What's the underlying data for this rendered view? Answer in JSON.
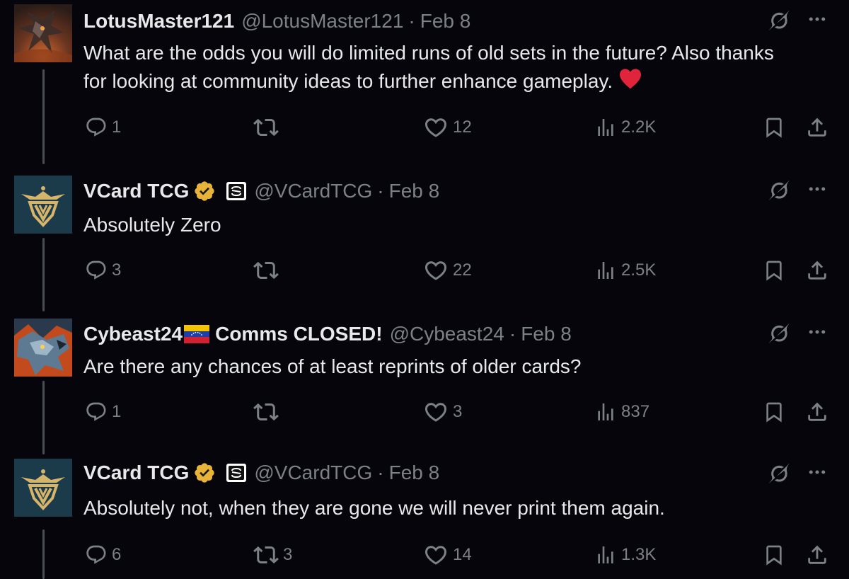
{
  "tweets": [
    {
      "name": "LotusMaster121",
      "handle": "@LotusMaster121",
      "separator": "·",
      "date": "Feb 8",
      "verified": false,
      "affiliate": false,
      "text": "What are the odds you will do limited runs of old sets in the future? Also thanks for looking at community ideas to further enhance gameplay.",
      "emoji": "red-heart",
      "replies": "1",
      "reposts": "",
      "likes": "12",
      "views": "2.2K",
      "avatar": "dragon-avatar"
    },
    {
      "name": "VCard TCG",
      "handle": "@VCardTCG",
      "separator": "·",
      "date": "Feb 8",
      "verified": true,
      "affiliate": true,
      "text": "Absolutely Zero",
      "replies": "3",
      "reposts": "",
      "likes": "22",
      "views": "2.5K",
      "avatar": "vcard-logo-avatar"
    },
    {
      "name": "Cybeast24",
      "name_suffix": "Comms CLOSED!",
      "handle": "@Cybeast24",
      "separator": "·",
      "date": "Feb 8",
      "verified": false,
      "affiliate": false,
      "flag": "venezuela-flag",
      "text": "Are there any chances of at least reprints of older cards?",
      "replies": "1",
      "reposts": "",
      "likes": "3",
      "views": "837",
      "avatar": "mech-dragon-avatar"
    },
    {
      "name": "VCard TCG",
      "handle": "@VCardTCG",
      "separator": "·",
      "date": "Feb 8",
      "verified": true,
      "affiliate": true,
      "text": "Absolutely not, when they are gone we will never print them again.",
      "replies": "6",
      "reposts": "3",
      "likes": "14",
      "views": "1.3K",
      "avatar": "vcard-logo-avatar"
    }
  ],
  "colors": {
    "background": "#06050b",
    "text": "#e7e9ea",
    "muted": "#7c8186",
    "verified_gold": "#e8b339",
    "heart_red": "#e0243c"
  },
  "icons": {
    "reply": "reply-icon",
    "repost": "repost-icon",
    "like": "heart-icon",
    "views": "views-icon",
    "bookmark": "bookmark-icon",
    "share": "share-icon",
    "grok": "grok-icon",
    "more": "more-icon"
  }
}
